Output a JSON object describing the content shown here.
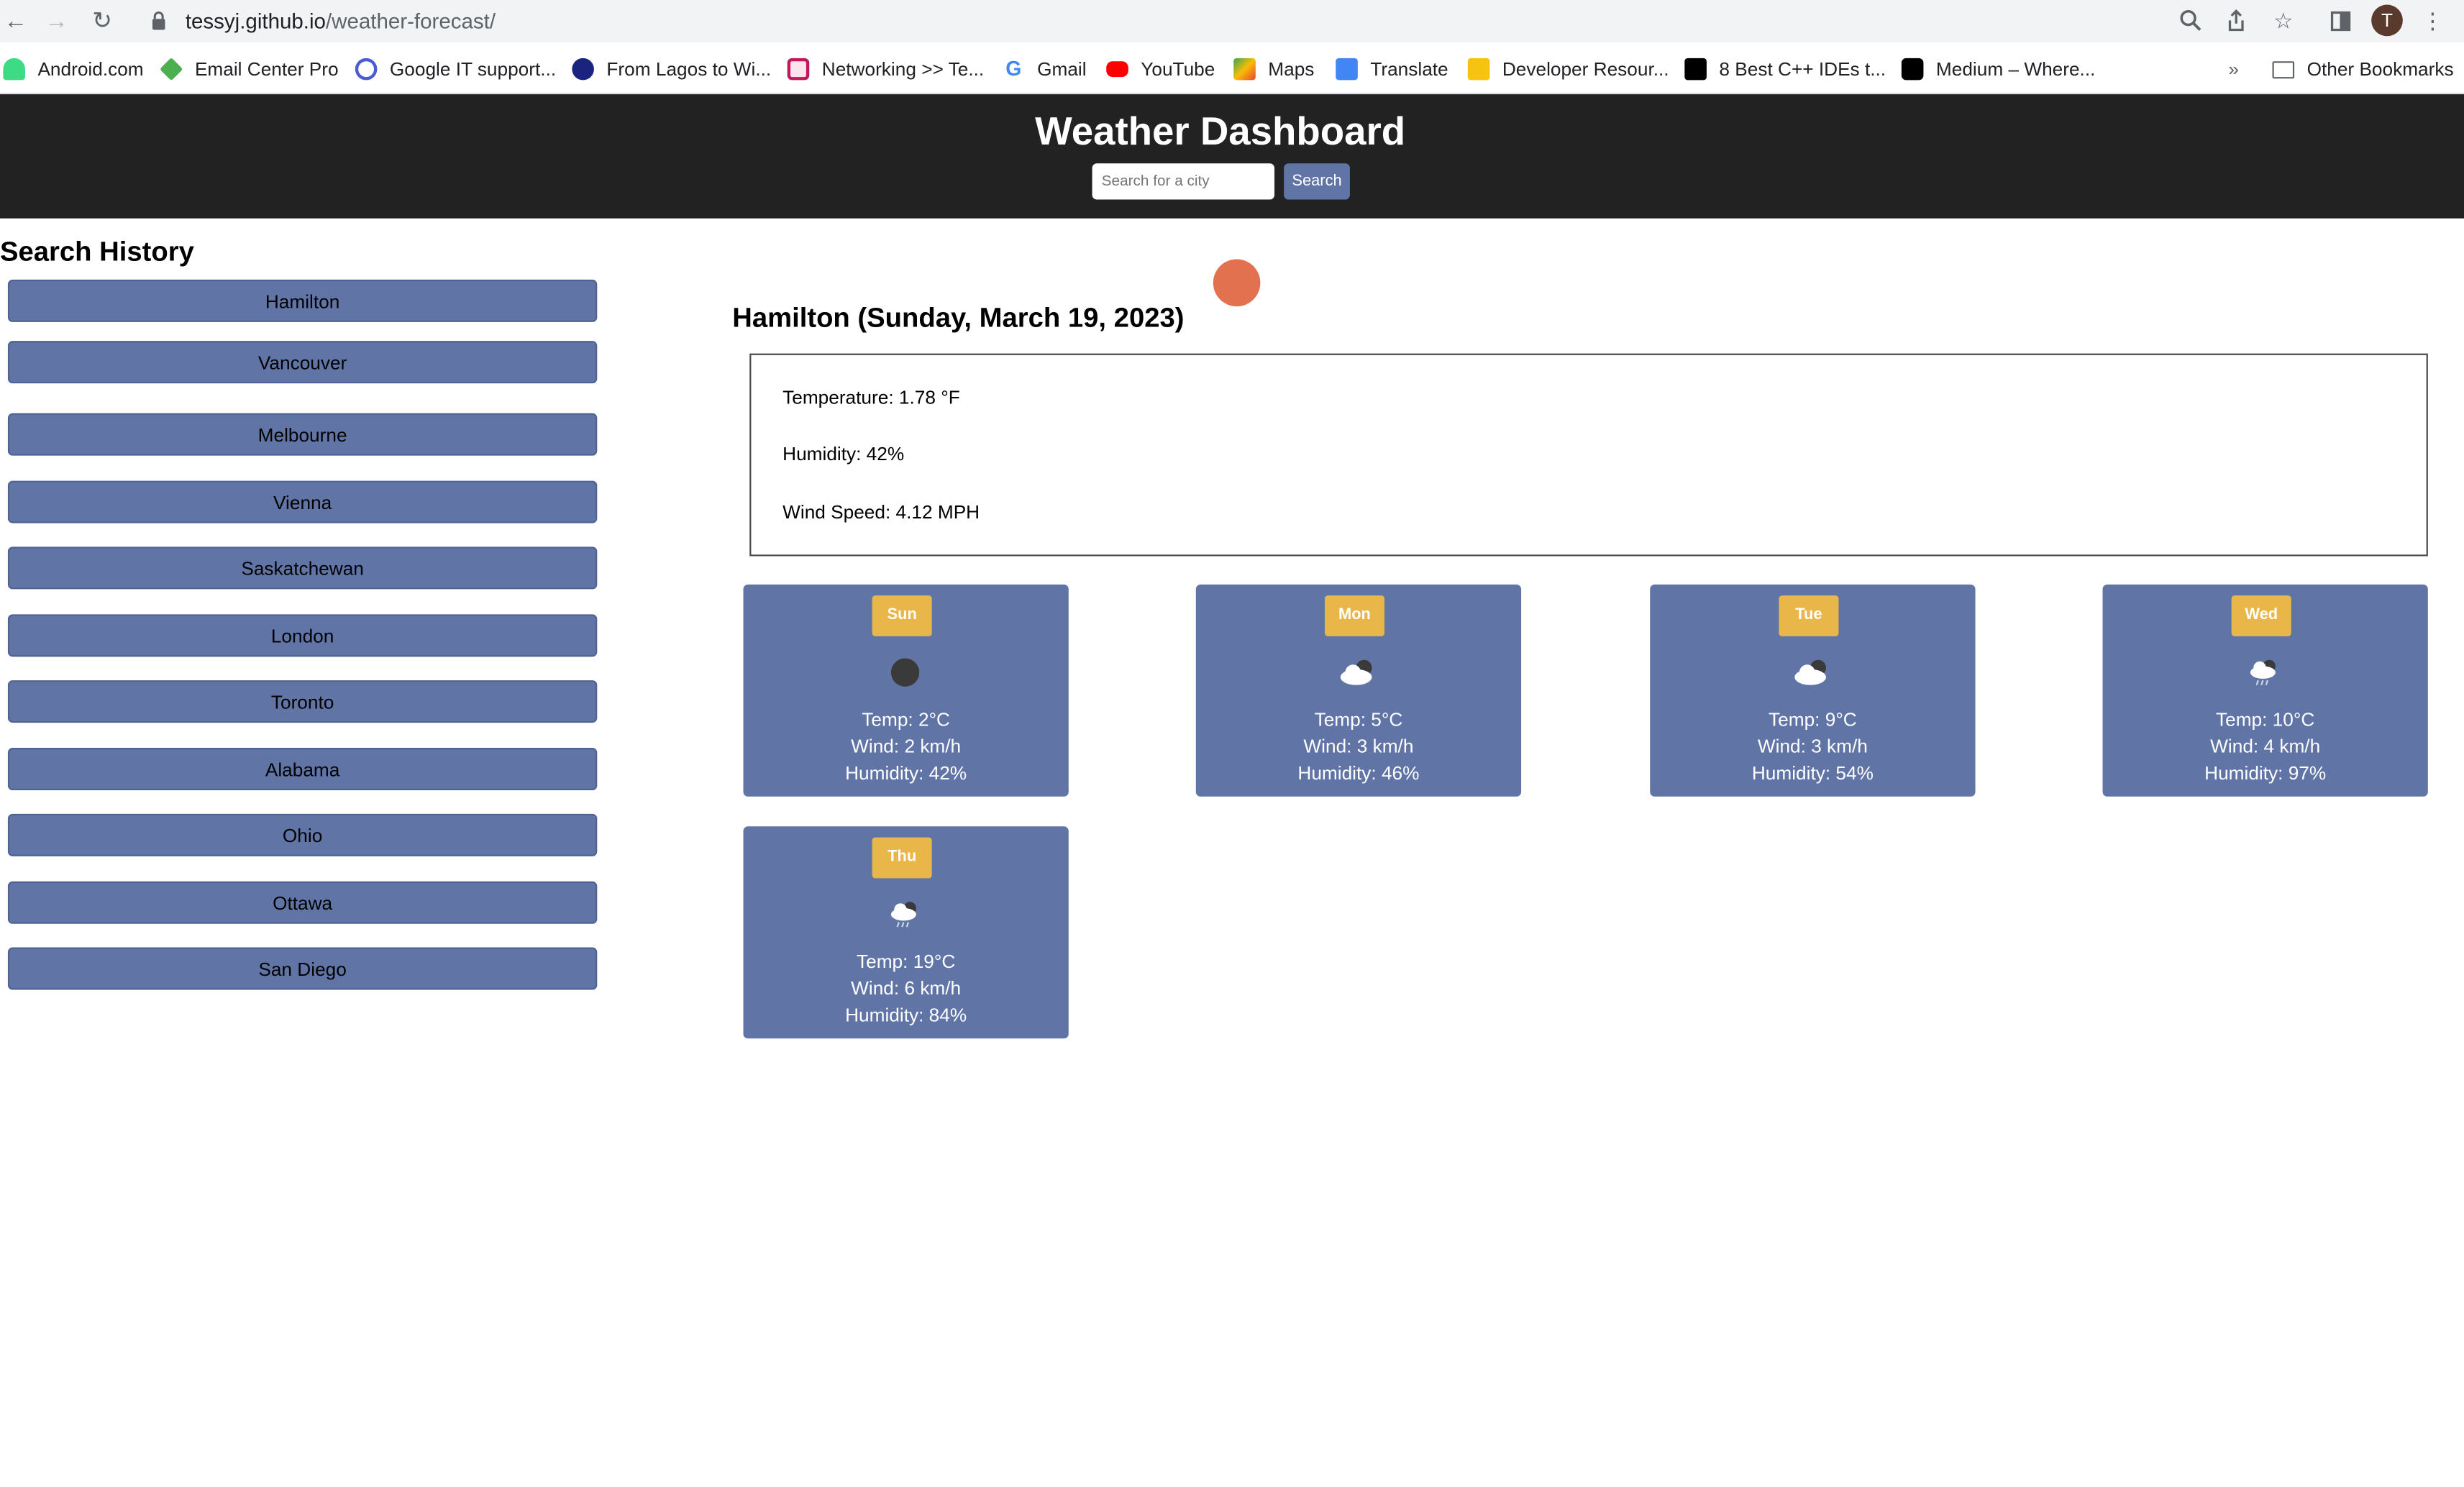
{
  "browser": {
    "url_host": "tessyj.github.io",
    "url_path": "/weather-forecast/",
    "profile_initial": "T",
    "bookmarks": [
      {
        "label": "Android.com",
        "icon": "android-icon",
        "color": "#3ddc84"
      },
      {
        "label": "Email Center Pro",
        "icon": "email-center-icon",
        "color": "#4caf50"
      },
      {
        "label": "Google IT support...",
        "icon": "q-icon",
        "color": "#4a5bd4"
      },
      {
        "label": "From Lagos to Wi...",
        "icon": "globe-icon",
        "color": "#1a237e"
      },
      {
        "label": "Networking >> Te...",
        "icon": "network-icon",
        "color": "#c2185b"
      },
      {
        "label": "Gmail",
        "icon": "google-icon",
        "color": "#4285f4"
      },
      {
        "label": "YouTube",
        "icon": "youtube-icon",
        "color": "#ff0000"
      },
      {
        "label": "Maps",
        "icon": "maps-icon",
        "color": "#34a853"
      },
      {
        "label": "Translate",
        "icon": "translate-icon",
        "color": "#4285f4"
      },
      {
        "label": "Developer Resour...",
        "icon": "fs-icon",
        "color": "#f6c40f"
      },
      {
        "label": "8 Best C++ IDEs t...",
        "icon": "dev-icon",
        "color": "#000000"
      },
      {
        "label": "Medium – Where...",
        "icon": "medium-icon",
        "color": "#000000"
      }
    ],
    "more_label": "»",
    "other_bookmarks": "Other Bookmarks"
  },
  "header": {
    "title": "Weather Dashboard",
    "search_placeholder": "Search for a city",
    "search_button": "Search"
  },
  "history": {
    "title": "Search History",
    "cities": [
      "Hamilton",
      "Vancouver",
      "Melbourne",
      "Vienna",
      "Saskatchewan",
      "London",
      "Toronto",
      "Alabama",
      "Ohio",
      "Ottawa",
      "San Diego"
    ]
  },
  "current": {
    "heading": "Hamilton (Sunday, March 19, 2023)",
    "temperature": "Temperature: 1.78 °F",
    "humidity": "Humidity: 42%",
    "wind": "Wind Speed: 4.12 MPH",
    "icon": "sun-icon",
    "icon_color": "#e2714f"
  },
  "forecast": [
    {
      "day": "Sun",
      "icon": "moon-icon",
      "temp": "Temp: 2°C",
      "wind": "Wind: 2 km/h",
      "humidity": "Humidity: 42%"
    },
    {
      "day": "Mon",
      "icon": "cloudy-night-icon",
      "temp": "Temp: 5°C",
      "wind": "Wind: 3 km/h",
      "humidity": "Humidity: 46%"
    },
    {
      "day": "Tue",
      "icon": "cloudy-night-icon",
      "temp": "Temp: 9°C",
      "wind": "Wind: 3 km/h",
      "humidity": "Humidity: 54%"
    },
    {
      "day": "Wed",
      "icon": "rain-night-icon",
      "temp": "Temp: 10°C",
      "wind": "Wind: 4 km/h",
      "humidity": "Humidity: 97%"
    },
    {
      "day": "Thu",
      "icon": "rain-night-icon",
      "temp": "Temp: 19°C",
      "wind": "Wind: 6 km/h",
      "humidity": "Humidity: 84%"
    }
  ],
  "colors": {
    "header_bg": "#222222",
    "card_bg": "#6075a6",
    "day_badge": "#e9b64a"
  }
}
